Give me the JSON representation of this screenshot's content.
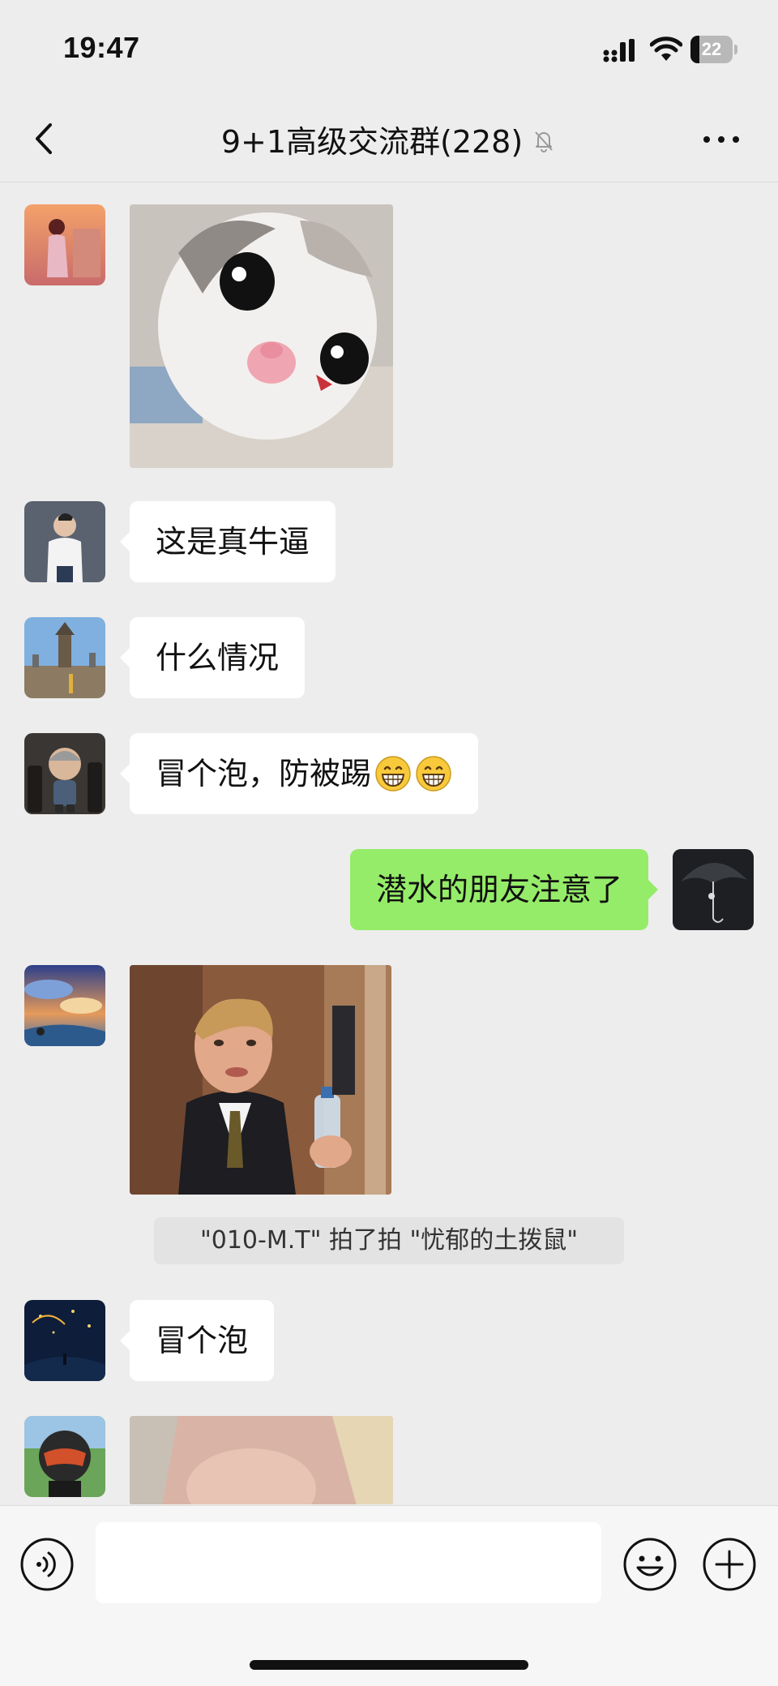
{
  "status_bar": {
    "time": "19:47",
    "battery_level": "22",
    "battery_fraction": 0.22
  },
  "header": {
    "title": "9+1高级交流群(228)",
    "back_icon": "chevron-left-icon",
    "mute_icon": "bell-slash-icon",
    "more_icon": "ellipsis-icon"
  },
  "messages": [
    {
      "type": "sticker",
      "sender": "other",
      "image": "cat-sticker"
    },
    {
      "type": "text",
      "sender": "other",
      "text": "这是真牛逼"
    },
    {
      "type": "text",
      "sender": "other",
      "text": "什么情况"
    },
    {
      "type": "text",
      "sender": "other",
      "text": "冒个泡，防被踢",
      "emoji": [
        "grinning-face-emoji",
        "grinning-face-emoji"
      ]
    },
    {
      "type": "text",
      "sender": "me",
      "text": "潜水的朋友注意了"
    },
    {
      "type": "sticker",
      "sender": "other",
      "image": "man-with-water-bottle-gif"
    },
    {
      "type": "system",
      "text": "\"010-M.T\" 拍了拍 \"忧郁的土拨鼠\""
    },
    {
      "type": "text",
      "sender": "other",
      "text": "冒个泡"
    },
    {
      "type": "sticker",
      "sender": "other",
      "image": "photo-sticker"
    }
  ],
  "input_bar": {
    "placeholder": "",
    "voice_icon": "voice-icon",
    "emoji_icon": "smiley-icon",
    "plus_icon": "plus-circle-icon"
  },
  "colors": {
    "background": "#ededed",
    "bubble_other": "#ffffff",
    "bubble_me": "#95ec69",
    "input_bar": "#f6f6f6"
  }
}
